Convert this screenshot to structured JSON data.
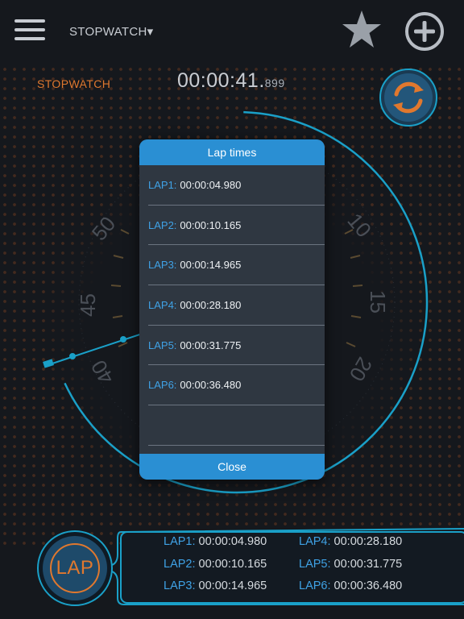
{
  "header": {
    "mode_dropdown": "STOPWATCH▾",
    "icons": {
      "menu": "hamburger-menu-icon",
      "favorite": "star-icon",
      "add": "plus-circle-icon"
    }
  },
  "stopwatch": {
    "mode_label": "STOPWATCH",
    "time_main": "00:00:41.",
    "time_ms": "899",
    "dial_numbers": [
      "50",
      "45",
      "40",
      "10",
      "15",
      "20"
    ]
  },
  "dialog": {
    "title": "Lap times",
    "laps": [
      {
        "label": "LAP1:",
        "time": "00:00:04.980"
      },
      {
        "label": "LAP2:",
        "time": "00:00:10.165"
      },
      {
        "label": "LAP3:",
        "time": "00:00:14.965"
      },
      {
        "label": "LAP4:",
        "time": "00:00:28.180"
      },
      {
        "label": "LAP5:",
        "time": "00:00:31.775"
      },
      {
        "label": "LAP6:",
        "time": "00:00:36.480"
      }
    ],
    "close_label": "Close"
  },
  "bottom": {
    "lap_button": "LAP",
    "laps": [
      {
        "label": "LAP1:",
        "time": "00:00:04.980"
      },
      {
        "label": "LAP2:",
        "time": "00:00:10.165"
      },
      {
        "label": "LAP3:",
        "time": "00:00:14.965"
      },
      {
        "label": "LAP4:",
        "time": "00:00:28.180"
      },
      {
        "label": "LAP5:",
        "time": "00:00:31.775"
      },
      {
        "label": "LAP6:",
        "time": "00:00:36.480"
      }
    ]
  },
  "colors": {
    "accent_orange": "#e0782e",
    "accent_blue": "#2a8fd3",
    "lap_label_blue": "#3fa2e6",
    "background": "#15181d"
  }
}
